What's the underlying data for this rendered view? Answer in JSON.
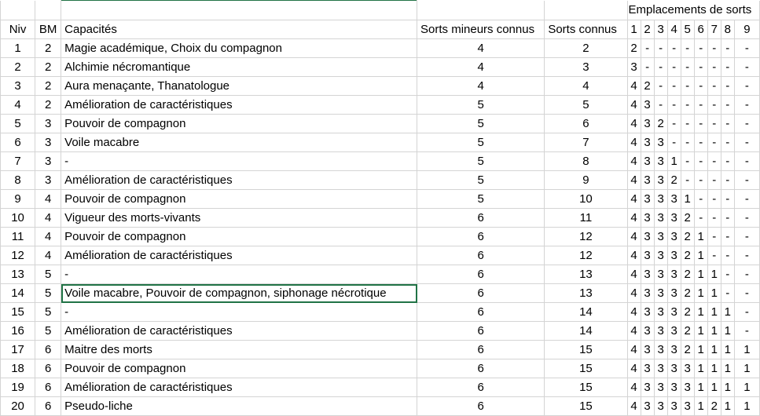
{
  "headers": {
    "group": "Emplacements de sorts",
    "niv": "Niv",
    "bm": "BM",
    "capacites": "Capacités",
    "mineurs": "Sorts mineurs connus",
    "connus": "Sorts connus",
    "slots": [
      "1",
      "2",
      "3",
      "4",
      "5",
      "6",
      "7",
      "8",
      "9"
    ]
  },
  "rows": [
    {
      "niv": "1",
      "bm": "2",
      "cap": "Magie académique, Choix du compagnon",
      "min": "4",
      "con": "2",
      "s": [
        "2",
        "-",
        "-",
        "-",
        "-",
        "-",
        "-",
        "-",
        "-"
      ]
    },
    {
      "niv": "2",
      "bm": "2",
      "cap": "Alchimie nécromantique",
      "min": "4",
      "con": "3",
      "s": [
        "3",
        "-",
        "-",
        "-",
        "-",
        "-",
        "-",
        "-",
        "-"
      ]
    },
    {
      "niv": "3",
      "bm": "2",
      "cap": "Aura menaçante, Thanatologue",
      "min": "4",
      "con": "4",
      "s": [
        "4",
        "2",
        "-",
        "-",
        "-",
        "-",
        "-",
        "-",
        "-"
      ]
    },
    {
      "niv": "4",
      "bm": "2",
      "cap": "Amélioration de caractéristiques",
      "min": "5",
      "con": "5",
      "s": [
        "4",
        "3",
        "-",
        "-",
        "-",
        "-",
        "-",
        "-",
        "-"
      ]
    },
    {
      "niv": "5",
      "bm": "3",
      "cap": "Pouvoir de compagnon",
      "min": "5",
      "con": "6",
      "s": [
        "4",
        "3",
        "2",
        "-",
        "-",
        "-",
        "-",
        "-",
        "-"
      ]
    },
    {
      "niv": "6",
      "bm": "3",
      "cap": "Voile macabre",
      "min": "5",
      "con": "7",
      "s": [
        "4",
        "3",
        "3",
        "-",
        "-",
        "-",
        "-",
        "-",
        "-"
      ]
    },
    {
      "niv": "7",
      "bm": "3",
      "cap": "-",
      "min": "5",
      "con": "8",
      "s": [
        "4",
        "3",
        "3",
        "1",
        "-",
        "-",
        "-",
        "-",
        "-"
      ]
    },
    {
      "niv": "8",
      "bm": "3",
      "cap": "Amélioration de caractéristiques",
      "min": "5",
      "con": "9",
      "s": [
        "4",
        "3",
        "3",
        "2",
        "-",
        "-",
        "-",
        "-",
        "-"
      ]
    },
    {
      "niv": "9",
      "bm": "4",
      "cap": "Pouvoir de compagnon",
      "min": "5",
      "con": "10",
      "s": [
        "4",
        "3",
        "3",
        "3",
        "1",
        "-",
        "-",
        "-",
        "-"
      ]
    },
    {
      "niv": "10",
      "bm": "4",
      "cap": "Vigueur des morts-vivants",
      "min": "6",
      "con": "11",
      "s": [
        "4",
        "3",
        "3",
        "3",
        "2",
        "-",
        "-",
        "-",
        "-"
      ]
    },
    {
      "niv": "11",
      "bm": "4",
      "cap": "Pouvoir de compagnon",
      "min": "6",
      "con": "12",
      "s": [
        "4",
        "3",
        "3",
        "3",
        "2",
        "1",
        "-",
        "-",
        "-"
      ]
    },
    {
      "niv": "12",
      "bm": "4",
      "cap": "Amélioration de caractéristiques",
      "min": "6",
      "con": "12",
      "s": [
        "4",
        "3",
        "3",
        "3",
        "2",
        "1",
        "-",
        "-",
        "-"
      ]
    },
    {
      "niv": "13",
      "bm": "5",
      "cap": "-",
      "min": "6",
      "con": "13",
      "s": [
        "4",
        "3",
        "3",
        "3",
        "2",
        "1",
        "1",
        "-",
        "-"
      ]
    },
    {
      "niv": "14",
      "bm": "5",
      "cap": "Voile macabre, Pouvoir de compagnon, siphonage nécrotique",
      "min": "6",
      "con": "13",
      "s": [
        "4",
        "3",
        "3",
        "3",
        "2",
        "1",
        "1",
        "-",
        "-"
      ]
    },
    {
      "niv": "15",
      "bm": "5",
      "cap": "-",
      "min": "6",
      "con": "14",
      "s": [
        "4",
        "3",
        "3",
        "3",
        "2",
        "1",
        "1",
        "1",
        "-"
      ]
    },
    {
      "niv": "16",
      "bm": "5",
      "cap": "Amélioration de caractéristiques",
      "min": "6",
      "con": "14",
      "s": [
        "4",
        "3",
        "3",
        "3",
        "2",
        "1",
        "1",
        "1",
        "-"
      ]
    },
    {
      "niv": "17",
      "bm": "6",
      "cap": "Maitre des morts",
      "min": "6",
      "con": "15",
      "s": [
        "4",
        "3",
        "3",
        "3",
        "2",
        "1",
        "1",
        "1",
        "1"
      ]
    },
    {
      "niv": "18",
      "bm": "6",
      "cap": "Pouvoir de compagnon",
      "min": "6",
      "con": "15",
      "s": [
        "4",
        "3",
        "3",
        "3",
        "3",
        "1",
        "1",
        "1",
        "1"
      ]
    },
    {
      "niv": "19",
      "bm": "6",
      "cap": "Amélioration de caractéristiques",
      "min": "6",
      "con": "15",
      "s": [
        "4",
        "3",
        "3",
        "3",
        "3",
        "1",
        "1",
        "1",
        "1"
      ]
    },
    {
      "niv": "20",
      "bm": "6",
      "cap": "Pseudo-liche",
      "min": "6",
      "con": "15",
      "s": [
        "4",
        "3",
        "3",
        "3",
        "3",
        "1",
        "2",
        "1",
        "1"
      ]
    }
  ]
}
